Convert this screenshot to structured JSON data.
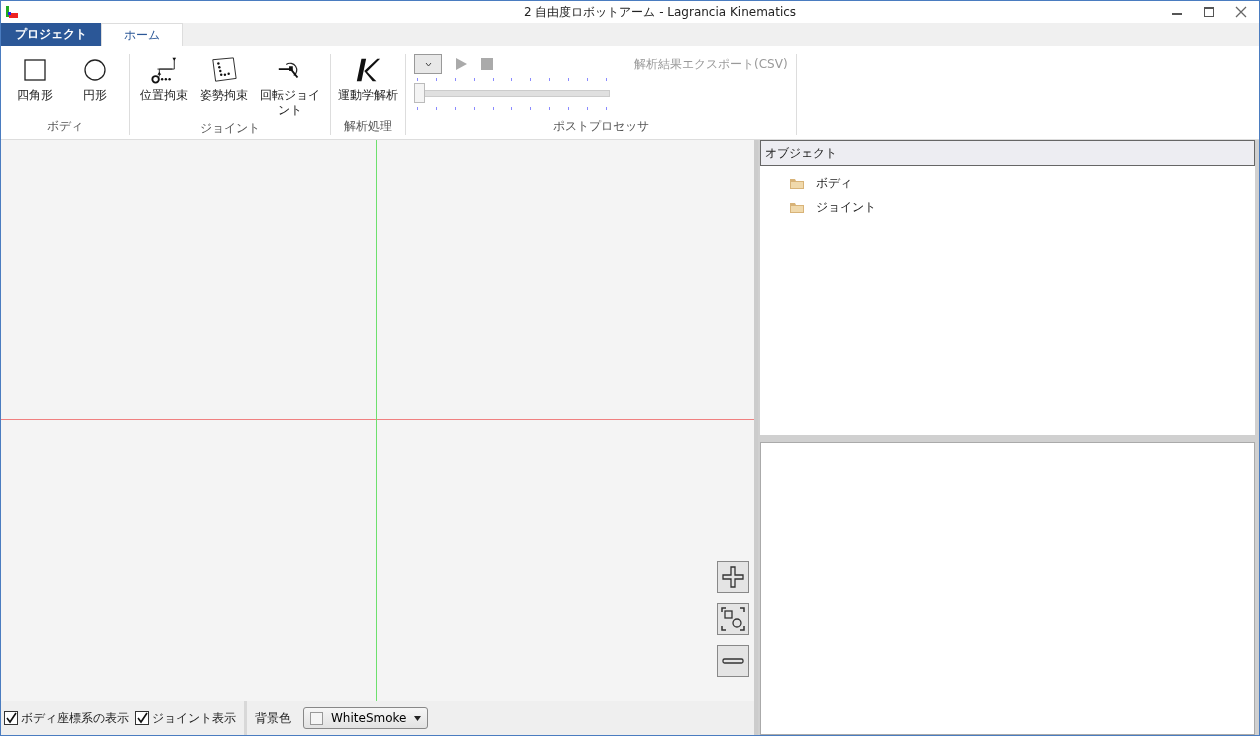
{
  "window": {
    "title": "2 自由度ロボットアーム - Lagrancia Kinematics"
  },
  "tabs": [
    {
      "label": "プロジェクト",
      "kind": "application",
      "selected": false
    },
    {
      "label": "ホーム",
      "kind": "tab",
      "selected": true
    }
  ],
  "ribbon": {
    "groups": [
      {
        "label": "ボディ",
        "kind": "buttons",
        "buttons": [
          {
            "label": "四角形",
            "kind": "square"
          },
          {
            "label": "円形",
            "kind": "circle"
          }
        ]
      },
      {
        "label": "ジョイント",
        "kind": "buttons",
        "buttons": [
          {
            "label": "位置拘束",
            "kind": "position"
          },
          {
            "label": "姿勢拘束",
            "kind": "orientation"
          },
          {
            "label": "回転ジョイント",
            "kind": "revolute"
          }
        ]
      },
      {
        "label": "解析処理",
        "kind": "buttons",
        "buttons": [
          {
            "label": "運動学解析",
            "kind": "kinematics"
          }
        ]
      },
      {
        "label": "ポストプロセッサ",
        "kind": "player",
        "play_disabled": true,
        "slider": {
          "level": 0
        },
        "export_button": {
          "label": "解析結果エクスポート(CSV)",
          "disabled": true
        }
      }
    ]
  },
  "status_bar": {
    "checkboxes": [
      {
        "label": "ボディ座標系の表示",
        "checked": true
      },
      {
        "label": "ジョイント表示",
        "checked": true
      }
    ],
    "background_label": "背景色",
    "background_dropdown": {
      "value": "WhiteSmoke",
      "color": "#f5f5f5"
    }
  },
  "object_panel": {
    "title": "オブジェクト",
    "items": [
      {
        "label": "ボディ"
      },
      {
        "label": "ジョイント"
      }
    ]
  }
}
